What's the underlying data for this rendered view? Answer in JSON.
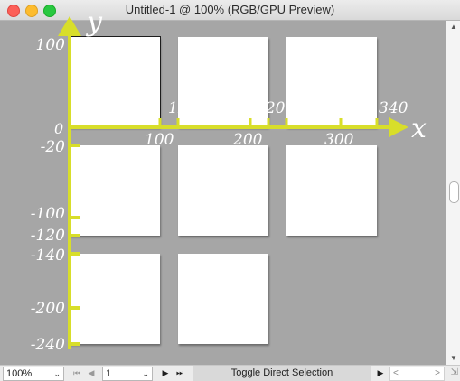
{
  "window": {
    "title": "Untitled-1 @ 100% (RGB/GPU Preview)"
  },
  "colors": {
    "axis": "#d8de2a",
    "canvas": "#a6a6a6",
    "artboard": "#ffffff"
  },
  "axes": {
    "x_name": "x",
    "y_name": "y",
    "origin_label": "0",
    "x_labels_below": [
      "100",
      "200",
      "300"
    ],
    "x_labels_above": [
      "120",
      "220",
      "240",
      "340"
    ],
    "y_labels": [
      "100",
      "-20",
      "-100",
      "-120",
      "-140",
      "-200",
      "-240"
    ]
  },
  "status": {
    "zoom": "100%",
    "page": "1",
    "toggle_label": "Toggle Direct Selection"
  },
  "icons": {
    "first": "first-page-icon",
    "prev": "previous-page-icon",
    "next": "next-page-icon",
    "last": "last-page-icon"
  }
}
